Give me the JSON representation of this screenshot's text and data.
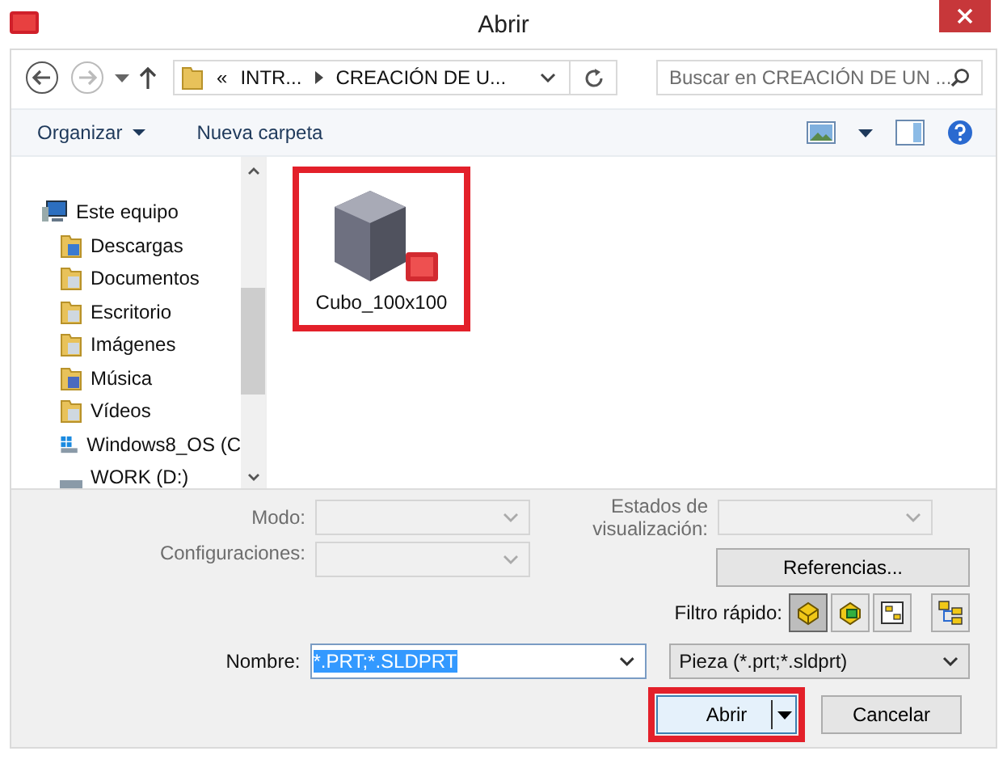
{
  "window": {
    "title": "Abrir"
  },
  "address": {
    "overflow_mark": "«",
    "crumbs": [
      "INTR...",
      "CREACIÓN DE U..."
    ]
  },
  "search": {
    "placeholder": "Buscar en CREACIÓN DE UN ..."
  },
  "toolbar": {
    "items": [
      {
        "label": "Organizar",
        "dropdown": true
      },
      {
        "label": "Nueva carpeta",
        "dropdown": false
      }
    ]
  },
  "nav": {
    "items": [
      {
        "label": "Este equipo",
        "kind": "computer",
        "children": [
          {
            "label": "Descargas",
            "kind": "downloads"
          },
          {
            "label": "Documentos",
            "kind": "documents"
          },
          {
            "label": "Escritorio",
            "kind": "desktop"
          },
          {
            "label": "Imágenes",
            "kind": "pictures"
          },
          {
            "label": "Música",
            "kind": "music"
          },
          {
            "label": "Vídeos",
            "kind": "videos"
          },
          {
            "label": "Windows8_OS (C",
            "kind": "system-drive"
          },
          {
            "label": "WORK (D:)",
            "kind": "drive"
          }
        ]
      }
    ]
  },
  "files": [
    {
      "name": "Cubo_100x100",
      "highlighted": true
    }
  ],
  "options": {
    "mode": {
      "label": "Modo:",
      "disabled": true
    },
    "configurations": {
      "label": "Configuraciones:",
      "disabled": true
    },
    "display_states": {
      "label": "Estados de visualización:",
      "disabled": true
    },
    "references_button": "Referencias...",
    "quick_filter": {
      "label": "Filtro rápido:",
      "buttons": [
        {
          "kind": "part",
          "selected": true
        },
        {
          "kind": "assembly",
          "selected": false
        },
        {
          "kind": "drawing",
          "selected": false
        },
        {
          "kind": "top-level",
          "selected": false
        }
      ]
    }
  },
  "filename": {
    "label": "Nombre:",
    "value": "*.PRT;*.SLDPRT",
    "selected": true
  },
  "file_type": {
    "value": "Pieza (*.prt;*.sldprt)"
  },
  "buttons": [
    {
      "label": "Abrir",
      "kind": "split",
      "highlighted": true
    },
    {
      "label": "Cancelar",
      "kind": "plain",
      "highlighted": false
    }
  ]
}
